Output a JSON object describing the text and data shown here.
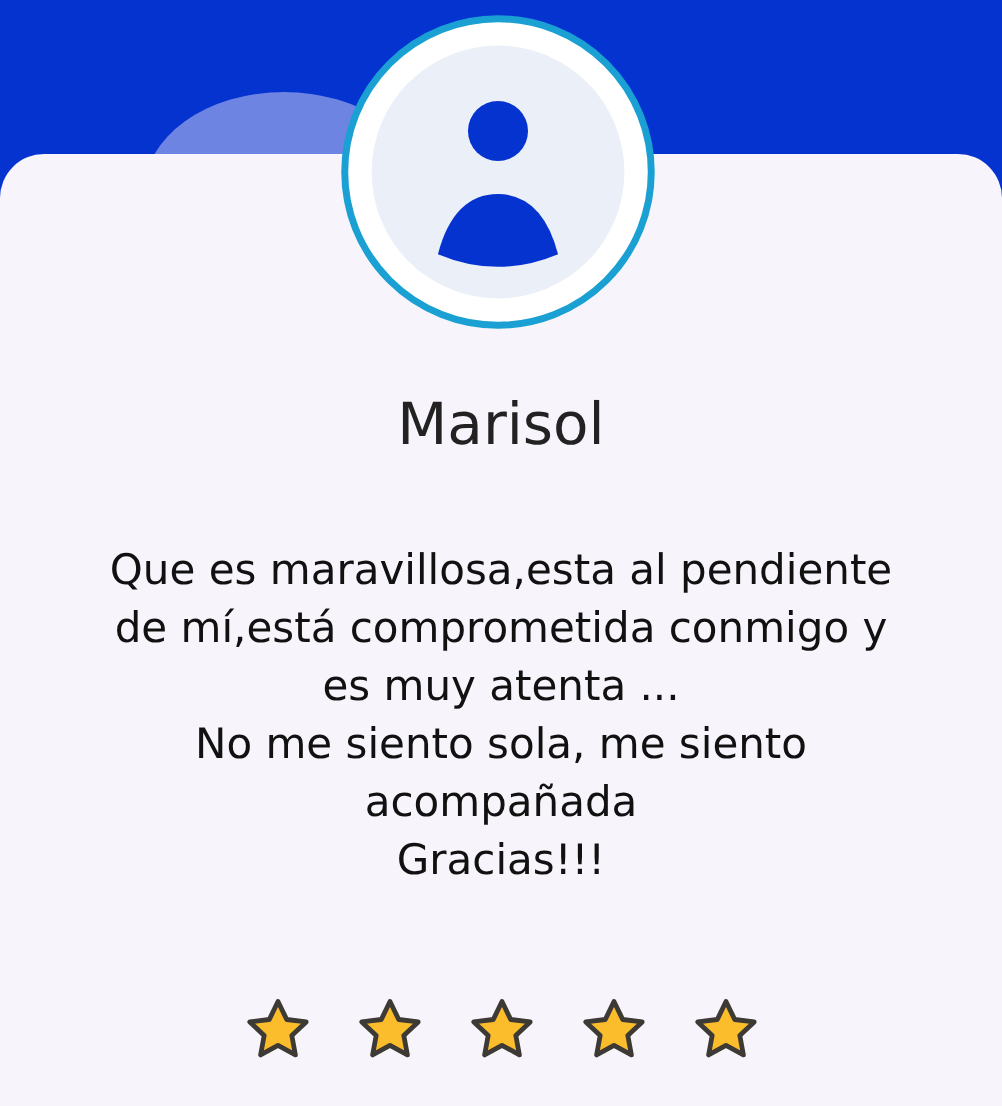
{
  "review": {
    "name": "Marisol",
    "text": "Que es maravillosa,esta al pendiente de mí,está comprometida conmigo y es muy atenta ...\nNo me siento sola, me siento acompañada\nGracias!!!",
    "stars": 5
  }
}
